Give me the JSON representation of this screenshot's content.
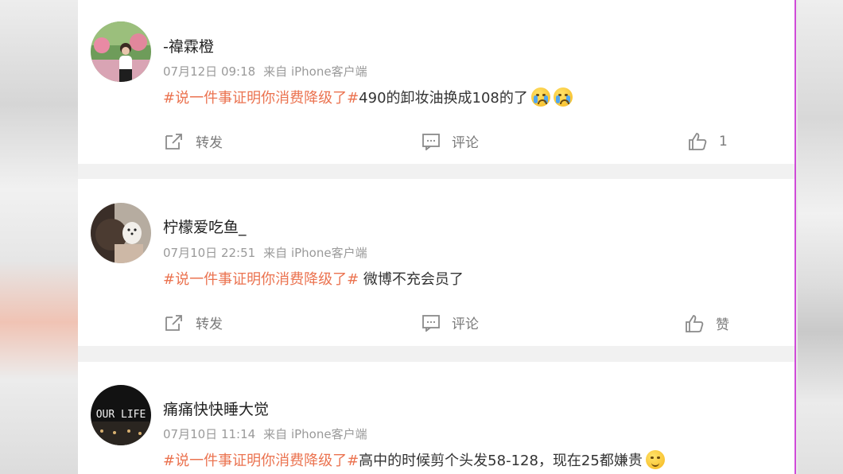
{
  "posts": [
    {
      "username": "-禕霖橙",
      "date": "07月12日 09:18",
      "source": "来自 iPhone客户端",
      "topic": "#说一件事证明你消费降级了#",
      "content": "490的卸妆油换成108的了",
      "emoji": [
        "crying-face-icon",
        "crying-face-icon"
      ],
      "repost_label": "转发",
      "comment_label": "评论",
      "like_label": "1"
    },
    {
      "username": "柠檬爱吃鱼_",
      "date": "07月10日 22:51",
      "source": "来自 iPhone客户端",
      "topic": "#说一件事证明你消费降级了#",
      "content": " 微博不充会员了",
      "repost_label": "转发",
      "comment_label": "评论",
      "like_label": "赞"
    },
    {
      "username": "痛痛快快睡大觉",
      "date": "07月10日 11:14",
      "source": "来自 iPhone客户端",
      "topic": "#说一件事证明你消费降级了#",
      "content": "高中的时候剪个头发58-128，现在25都嫌贵",
      "emoji": [
        "thinking-face-icon"
      ],
      "avatar_text": "OUR LIFE"
    }
  ],
  "colors": {
    "topic": "#eb7350",
    "accent_line": "#d04ad8"
  }
}
